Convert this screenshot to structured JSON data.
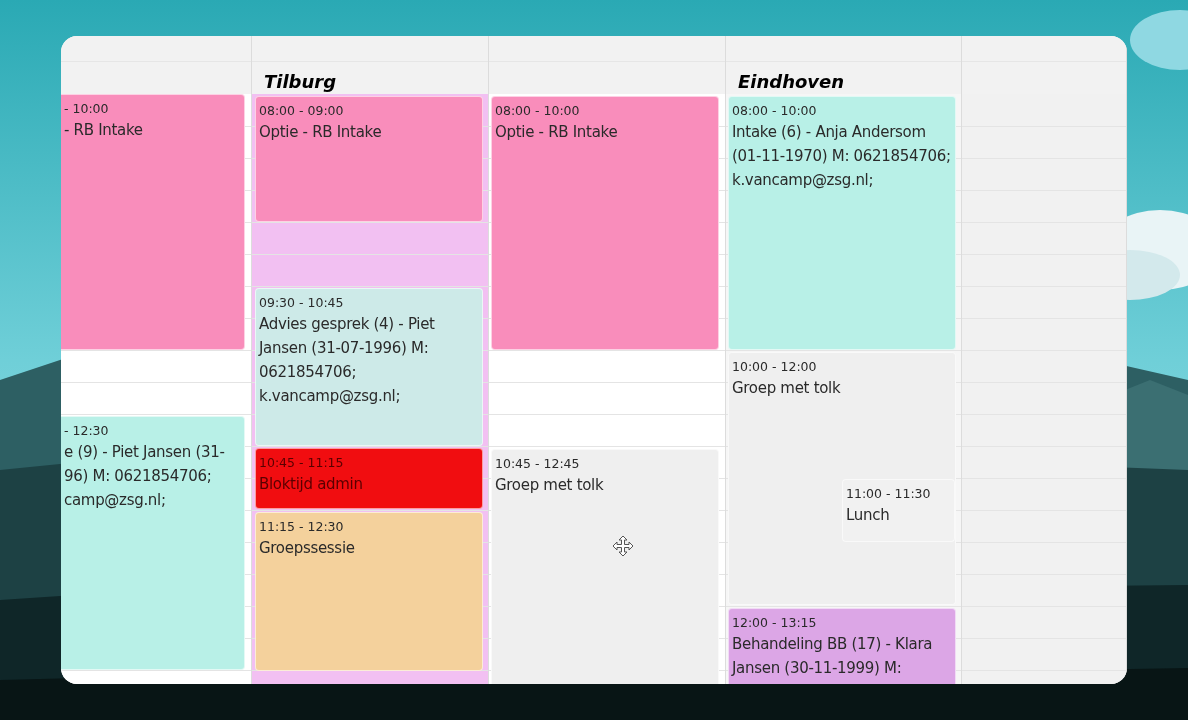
{
  "columns": [
    {
      "color": "#ffffff",
      "events": [
        {
          "time": "- 10:00",
          "title": "- RB Intake",
          "color": "#f98dbb"
        },
        {
          "time": "- 12:30",
          "title": "e (9) - Piet Jansen (31-\n96) M: 0621854706;\ncamp@zsg.nl;",
          "color": "#b8f0e7"
        }
      ]
    },
    {
      "title": "Tilburg",
      "color": "#f2c0f2",
      "events": [
        {
          "time": "08:00 - 09:00",
          "title": "Optie - RB Intake",
          "color": "#f98dbb"
        },
        {
          "time": "09:30 - 10:45",
          "title": "Advies gesprek (4) - Piet\nJansen (31-07-1996) M:\n0621854706;\nk.vancamp@zsg.nl;",
          "color": "#cdeae8"
        },
        {
          "time": "10:45 - 11:15",
          "title": "Bloktijd admin",
          "color": "#f10d10"
        },
        {
          "time": "11:15 - 12:30",
          "title": "Groepssessie",
          "color": "#f4d19c"
        }
      ]
    },
    {
      "color": "#ffffff",
      "events": [
        {
          "time": "08:00 - 10:00",
          "title": "Optie - RB Intake",
          "color": "#f98dbb"
        },
        {
          "time": "10:45 - 12:45",
          "title": "Groep met tolk",
          "color": "#efefef"
        }
      ]
    },
    {
      "title": "Eindhoven",
      "color": "#f6f6f6",
      "events": [
        {
          "time": "08:00 - 10:00",
          "title": "Intake (6) - Anja Andersom\n(01-11-1970) M: 0621854706;\nk.vancamp@zsg.nl;",
          "color": "#b8f0e7"
        },
        {
          "time": "10:00 - 12:00",
          "title": "Groep met tolk",
          "color": "#efefef"
        },
        {
          "time": "11:00 - 11:30",
          "title": "Lunch",
          "color": "#f1f1f1"
        },
        {
          "time": "12:00 - 13:15",
          "title": "Behandeling BB (17) - Klara\nJansen (30-11-1999) M:",
          "color": "#dca6e6"
        }
      ]
    },
    {
      "color": "#f1f1f1"
    }
  ]
}
